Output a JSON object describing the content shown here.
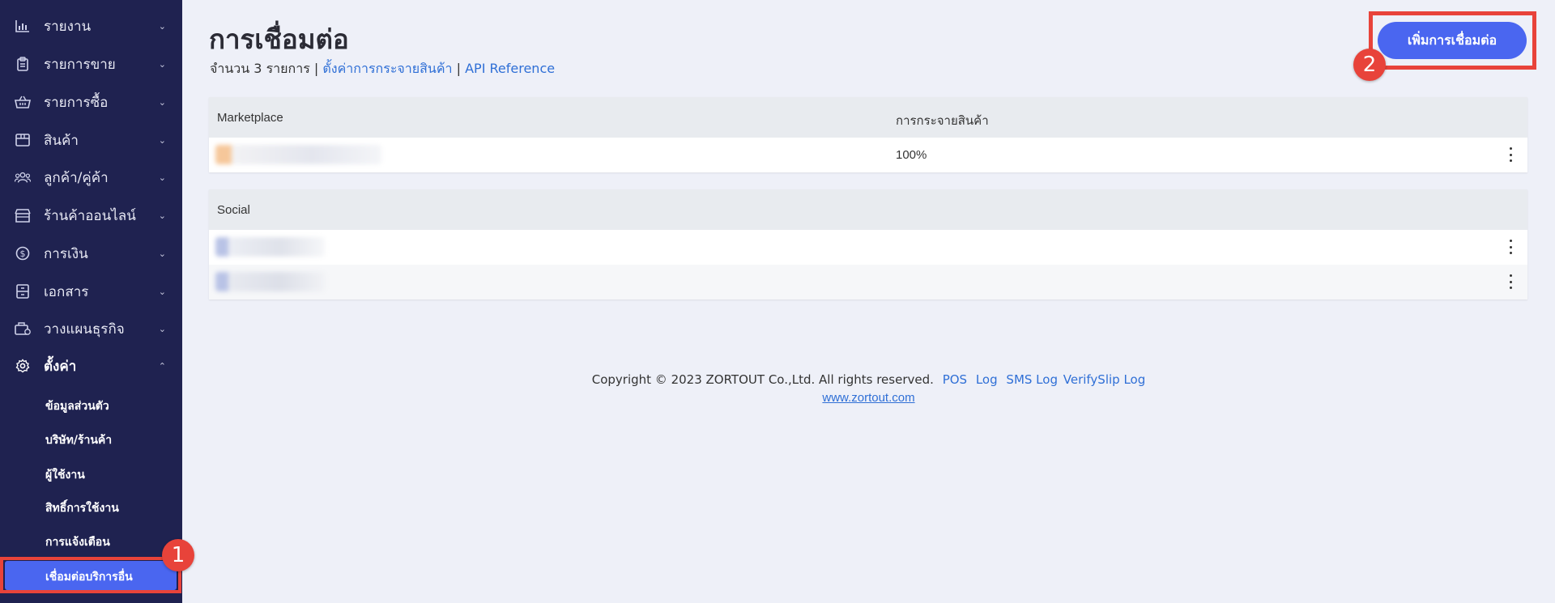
{
  "sidebar": {
    "items": [
      {
        "label": "รายงาน",
        "icon": "bar-chart-icon",
        "chevron": "⌄"
      },
      {
        "label": "รายการขาย",
        "icon": "clipboard-icon",
        "chevron": "⌄"
      },
      {
        "label": "รายการซื้อ",
        "icon": "basket-icon",
        "chevron": "⌄"
      },
      {
        "label": "สินค้า",
        "icon": "box-icon",
        "chevron": "⌄"
      },
      {
        "label": "ลูกค้า/คู่ค้า",
        "icon": "users-icon",
        "chevron": "⌄"
      },
      {
        "label": "ร้านค้าออนไลน์",
        "icon": "store-icon",
        "chevron": "⌄"
      },
      {
        "label": "การเงิน",
        "icon": "dollar-circle-icon",
        "chevron": "⌄"
      },
      {
        "label": "เอกสาร",
        "icon": "archive-icon",
        "chevron": "⌄"
      },
      {
        "label": "วางแผนธุรกิจ",
        "icon": "briefcase-icon",
        "chevron": "⌄"
      },
      {
        "label": "ตั้งค่า",
        "icon": "gear-icon",
        "chevron": "⌃"
      }
    ],
    "sub_items": [
      "ข้อมูลส่วนตัว",
      "บริษัท/ร้านค้า",
      "ผู้ใช้งาน",
      "สิทธิ์การใช้งาน",
      "การแจ้งเตือน"
    ],
    "active_sub": "เชื่อมต่อบริการอื่น"
  },
  "badges": {
    "one": "1",
    "two": "2"
  },
  "page": {
    "title": "การเชื่อมต่อ",
    "count_text": "จำนวน 3 รายการ",
    "sep": "|",
    "link_distribution": "ตั้งค่าการกระจายสินค้า",
    "link_api": "API Reference",
    "add_button": "เพิ่มการเชื่อมต่อ"
  },
  "marketplace": {
    "header_col1": "Marketplace",
    "header_col2": "การกระจายสินค้า",
    "rows": [
      {
        "percent": "100%"
      }
    ]
  },
  "social": {
    "header": "Social"
  },
  "footer": {
    "copyright": "Copyright © 2023 ZORTOUT Co.,Ltd. All rights reserved.",
    "links": [
      "POS",
      "Log",
      "SMS Log",
      "VerifySlip Log"
    ],
    "website": "www.zortout.com"
  },
  "colors": {
    "sidebar_bg": "#1f2250",
    "accent": "#4a66f0",
    "highlight": "#e8433a",
    "link": "#2f6fd6",
    "page_bg": "#eef0f8"
  }
}
